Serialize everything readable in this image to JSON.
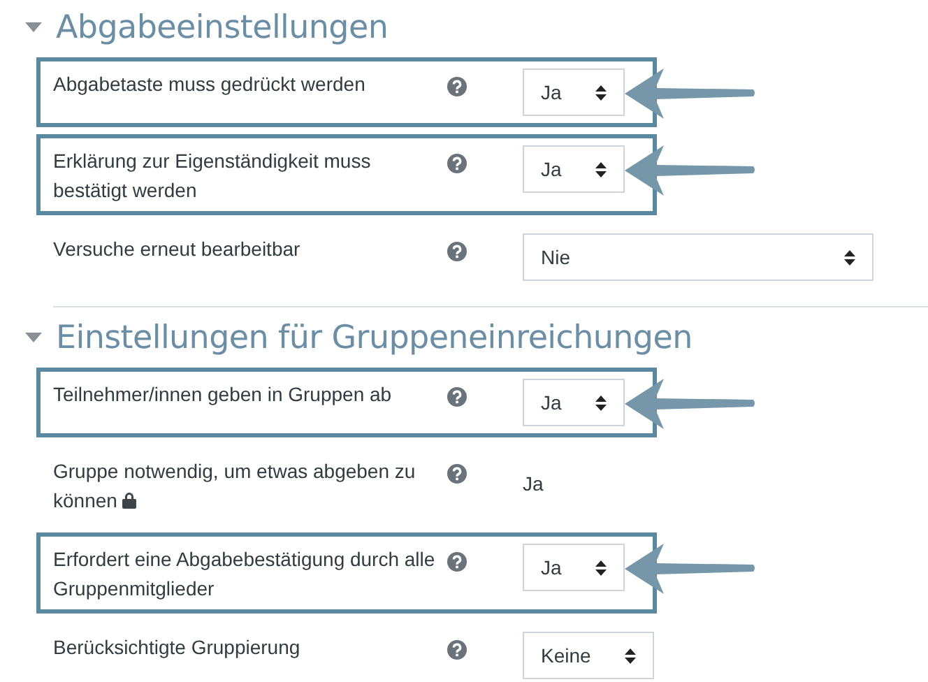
{
  "sections": [
    {
      "title": "Abgabeeinstellungen",
      "expanded": true,
      "rows": [
        {
          "label": "Abgabetaste muss gedrückt werden",
          "kind": "select",
          "value": "Ja",
          "highlighted": true,
          "locked": false
        },
        {
          "label": "Erklärung zur Eigenständigkeit muss bestätigt werden",
          "kind": "select",
          "value": "Ja",
          "highlighted": true,
          "locked": false
        },
        {
          "label": "Versuche erneut bearbeitbar",
          "kind": "wide_select",
          "value": "Nie",
          "highlighted": false,
          "locked": false
        }
      ]
    },
    {
      "title": "Einstellungen für Gruppeneinreichungen",
      "expanded": true,
      "rows": [
        {
          "label": "Teilnehmer/innen geben in Gruppen ab",
          "kind": "select",
          "value": "Ja",
          "highlighted": true,
          "locked": false
        },
        {
          "label": "Gruppe notwendig, um etwas abgeben zu können",
          "kind": "static",
          "value": "Ja",
          "highlighted": false,
          "locked": true
        },
        {
          "label": "Erfordert eine Abgabebestätigung durch alle Gruppenmitglieder",
          "kind": "select",
          "value": "Ja",
          "highlighted": true,
          "locked": false
        },
        {
          "label": "Berücksichtigte Gruppierung",
          "kind": "select",
          "value": "Keine",
          "highlighted": false,
          "locked": false
        }
      ]
    }
  ]
}
